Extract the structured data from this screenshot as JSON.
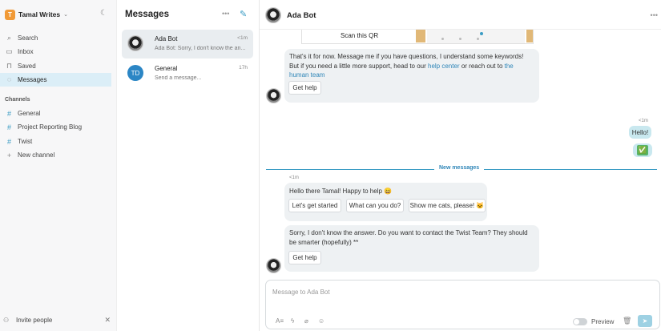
{
  "workspace": {
    "initial": "T",
    "name": "Tamal Writes"
  },
  "nav": [
    {
      "label": "Search"
    },
    {
      "label": "Inbox"
    },
    {
      "label": "Saved"
    },
    {
      "label": "Messages"
    }
  ],
  "channels": {
    "heading": "Channels",
    "items": [
      {
        "label": "General"
      },
      {
        "label": "Project Reporting Blog"
      },
      {
        "label": "Twist"
      }
    ],
    "new_label": "New channel"
  },
  "invite_label": "Invite people",
  "list": {
    "title": "Messages",
    "conversations": [
      {
        "name": "Ada Bot",
        "time": "<1m",
        "preview": "Ada Bot: Sorry, I don't know the an..."
      },
      {
        "name": "General",
        "initials": "TD",
        "time": "17h",
        "preview": "Send a message..."
      }
    ]
  },
  "chat": {
    "title": "Ada Bot",
    "qr_text": "Scan this QR",
    "msg1": {
      "part1": "That's it for now. Message me if you have questions, I understand some keywords! But if you need a little more support, head to our ",
      "link1": "help center",
      "part2": " or reach out to ",
      "link2": "the human team",
      "button": "Get help"
    },
    "outgoing": {
      "time": "<1m",
      "text": "Hello!",
      "check": "✅"
    },
    "new_messages_label": "New messages",
    "msg2": {
      "time": "<1m",
      "text": "Hello there Tamal! Happy to help 😄",
      "buttons": [
        "Let's get started",
        "What can you do?",
        "Show me cats, please! 🐱"
      ]
    },
    "msg3": {
      "text": "Sorry, I don't know the answer. Do you want to contact the Twist Team? They should be smarter (hopefully) **",
      "button": "Get help"
    },
    "composer": {
      "placeholder": "Message to Ada Bot",
      "preview_label": "Preview"
    }
  },
  "colors": {
    "accent": "#3b9cc4",
    "workspace_logo": "#f19a37",
    "active_nav": "#dbeef7",
    "bubble": "#eef1f3",
    "outgoing_bubble": "#c9e8ef"
  }
}
